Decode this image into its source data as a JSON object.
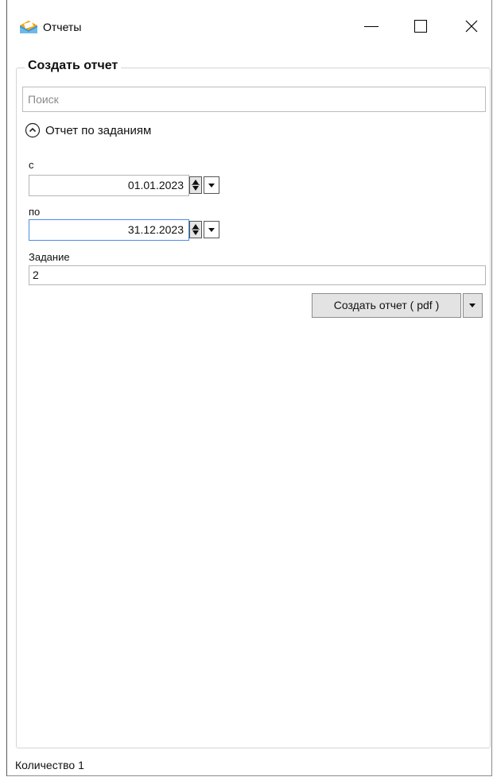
{
  "window": {
    "title": "Отчеты"
  },
  "group": {
    "title": "Создать отчет",
    "search_placeholder": "Поиск"
  },
  "expander": {
    "label": "Отчет по заданиям",
    "expanded": true
  },
  "form": {
    "from_label": "с",
    "from_value": "01.01.2023",
    "to_label": "по",
    "to_value": "31.12.2023",
    "task_label": "Задание",
    "task_value": "2",
    "create_button": "Создать отчет ( pdf )"
  },
  "status": {
    "count_text": "Количество 1"
  },
  "colors": {
    "focus_border": "#4a8ce6",
    "button_bg": "#e3e3e3",
    "group_border": "#d4d4d4"
  },
  "icons": {
    "app": "envelope-app-icon",
    "expander": "chevron-up-circle-icon"
  }
}
